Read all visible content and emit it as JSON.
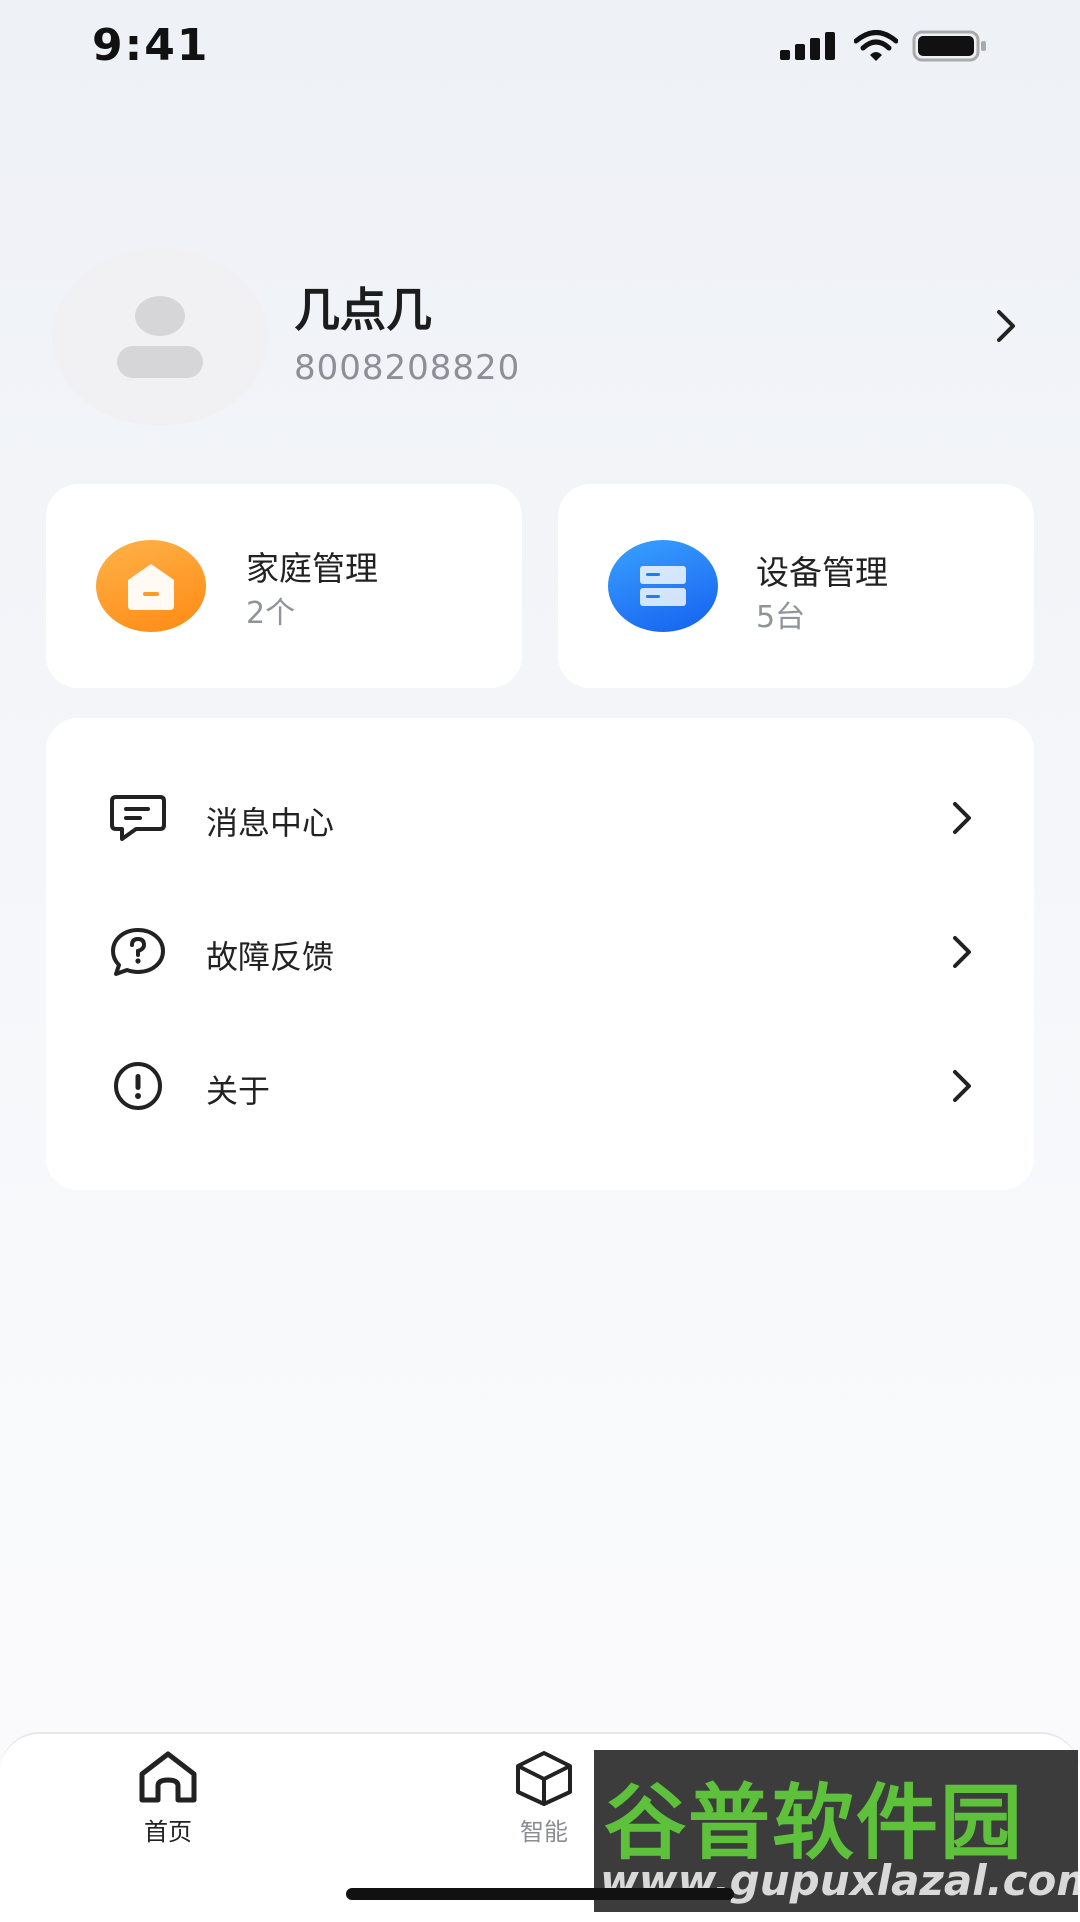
{
  "status_bar": {
    "time": "9:41"
  },
  "profile": {
    "name": "几点几",
    "phone": "8008208820"
  },
  "cards": {
    "home": {
      "title": "家庭管理",
      "count": "2个",
      "icon": "home-icon",
      "color": "#ff9a24"
    },
    "device": {
      "title": "设备管理",
      "count": "5台",
      "icon": "server-icon",
      "color": "#2479f5"
    }
  },
  "menu": {
    "items": [
      {
        "label": "消息中心",
        "icon": "message-icon"
      },
      {
        "label": "故障反馈",
        "icon": "question-icon"
      },
      {
        "label": "关于",
        "icon": "info-icon"
      }
    ]
  },
  "tabs": [
    {
      "label": "首页",
      "icon": "home-tab-icon",
      "active": true
    },
    {
      "label": "智能",
      "icon": "cube-icon",
      "active": false
    },
    {
      "label": "",
      "icon": "person-icon",
      "active": false
    }
  ],
  "watermark": {
    "line1": "谷普软件园",
    "line2": "www.gupuxlazal.com"
  }
}
